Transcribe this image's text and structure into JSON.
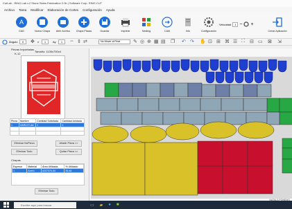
{
  "window": {
    "title": "CutLab - RiNG.Lab v.2 Stone Slabs Fabrication 2.0b | Software Corp. RING.CUT"
  },
  "menu": [
    "Archivo",
    "Tarea",
    "Modificar",
    "Elaboración de Cortes",
    "Configuración",
    "Ayuda"
  ],
  "toolbar": {
    "items": [
      {
        "label": "CAD",
        "icon": "cad-icon"
      },
      {
        "label": "Nuevo Chapa",
        "icon": "new-slab-icon"
      },
      {
        "label": "Abrir Archivo",
        "icon": "open-file-icon"
      },
      {
        "label": "Chapa Placas",
        "icon": "slab-plates-icon"
      },
      {
        "label": "Guardar",
        "icon": "save-icon"
      },
      {
        "label": "Imprimir",
        "icon": "print-icon"
      },
      {
        "label": "Nesting",
        "icon": "nesting-icon"
      },
      {
        "label": "CAM",
        "icon": "cam-icon"
      },
      {
        "label": "Info",
        "icon": "info-icon"
      },
      {
        "label": "Configuración",
        "icon": "settings-icon"
      },
      {
        "label": "Cerrar Aplicación",
        "icon": "exit-icon"
      }
    ],
    "speed_label": "Velocidad",
    "speed_value": "1"
  },
  "toolbar2": {
    "angle_label": "Ángulo",
    "angle_value": "0",
    "x_label": "x",
    "x_value": "1",
    "y_label": "Ay",
    "y_value": "1",
    "mode_value": "No Mover al Final"
  },
  "left": {
    "pieces_title": "Piezas Importadas",
    "piece_id": "K-12",
    "size_label": "Tamaño: 1130x730x4",
    "table_headers": [
      "Pieza",
      "Nombre",
      "Cantidad Solicitada",
      "Cantidad Anidada"
    ],
    "table_rows": [
      [
        "1",
        "HARLEY.dxf",
        "1",
        "0"
      ]
    ],
    "buttons": {
      "delete_nofields": "Eliminar NoPieza",
      "add_piece": "Añadir Pieza >>",
      "delete_all": "Eliminar Todo",
      "remove_piece": "Quitar Pieza <<",
      "delete_all_2": "Eliminar Todo"
    },
    "slabs_title": "Chapas",
    "slabs_headers": [
      "Espesor",
      "Material",
      "Área Utilizada",
      "% Utilizado"
    ],
    "slabs_rows": [
      [
        "1",
        "Acero",
        "4207370.00",
        "35.46"
      ]
    ]
  },
  "canvas": {
    "status": "NATALS PONEMG"
  },
  "taskbar": {
    "search_placeholder": "Escribe aquí para buscar"
  },
  "colors": {
    "blue_piece": "#1f3fd0",
    "green_piece": "#27a845",
    "gray_piece": "#8fa6b6",
    "yellow_piece": "#d9c12a",
    "red_piece": "#c8102e",
    "board": "#d9d9d9"
  }
}
